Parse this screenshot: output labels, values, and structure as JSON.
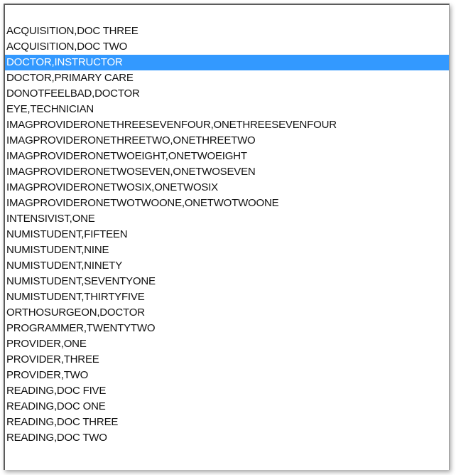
{
  "listbox": {
    "selected_index": 2,
    "selection_color": "#3399ff",
    "items": [
      "ACQUISITION,DOC THREE",
      "ACQUISITION,DOC TWO",
      "DOCTOR,INSTRUCTOR",
      "DOCTOR,PRIMARY CARE",
      "DONOTFEELBAD,DOCTOR",
      "EYE,TECHNICIAN",
      "IMAGPROVIDERONETHREESEVENFOUR,ONETHREESEVENFOUR",
      "IMAGPROVIDERONETHREETWO,ONETHREETWO",
      "IMAGPROVIDERONETWOEIGHT,ONETWOEIGHT",
      "IMAGPROVIDERONETWOSEVEN,ONETWOSEVEN",
      "IMAGPROVIDERONETWOSIX,ONETWOSIX",
      "IMAGPROVIDERONETWOTWOONE,ONETWOTWOONE",
      "INTENSIVIST,ONE",
      "NUMISTUDENT,FIFTEEN",
      "NUMISTUDENT,NINE",
      "NUMISTUDENT,NINETY",
      "NUMISTUDENT,SEVENTYONE",
      "NUMISTUDENT,THIRTYFIVE",
      "ORTHOSURGEON,DOCTOR",
      "PROGRAMMER,TWENTYTWO",
      "PROVIDER,ONE",
      "PROVIDER,THREE",
      "PROVIDER,TWO",
      "READING,DOC FIVE",
      "READING,DOC ONE",
      "READING,DOC THREE",
      "READING,DOC TWO"
    ]
  }
}
